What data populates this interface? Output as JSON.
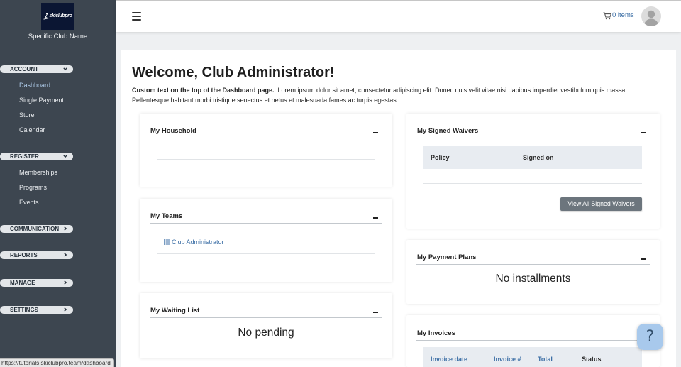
{
  "colors": {
    "sidebar_bg": "#3d4650",
    "accent": "#3b6ea5",
    "active_nav": "#b3d1f0",
    "button_bg": "#6c757d",
    "help_bg": "#a8c9ec",
    "page_bg": "#eef0f2"
  },
  "sidebar": {
    "logo": {
      "text": "skiclubpro",
      "icon": "skier-icon"
    },
    "club_name": "Specific Club Name",
    "sections": [
      {
        "label": "ACCOUNT",
        "chevron": "chevron-down-icon",
        "items": [
          {
            "label": "Dashboard",
            "active": true
          },
          {
            "label": "Single Payment"
          },
          {
            "label": "Store"
          },
          {
            "label": "Calendar"
          }
        ]
      },
      {
        "label": "REGISTER",
        "chevron": "chevron-down-icon",
        "items": [
          {
            "label": "Memberships"
          },
          {
            "label": "Programs"
          },
          {
            "label": "Events"
          }
        ]
      },
      {
        "label": "COMMUNICATION",
        "chevron": "chevron-right-icon"
      },
      {
        "label": "REPORTS",
        "chevron": "chevron-right-icon"
      },
      {
        "label": "MANAGE",
        "chevron": "chevron-right-icon"
      },
      {
        "label": "SETTINGS",
        "chevron": "chevron-right-icon"
      }
    ]
  },
  "header": {
    "menu_icon": "hamburger-icon",
    "cart_icon": "cart-icon",
    "cart_label": "0 items",
    "avatar_icon": "user-avatar-icon"
  },
  "main": {
    "title": "Welcome, Club Administrator!",
    "intro_bold": "Custom text on the top of the Dashboard page.",
    "intro_text": "Lorem ipsum dolor sit amet, consectetur adipiscing elit. Donec quis velit vitae nisi dapibus imperdiet vestibulum quis massa. Pellentesque habitant morbi tristique senectus et netus et malesuada fames ac turpis egestas.",
    "collapse_icon": "minus-icon",
    "cards": {
      "household": {
        "title": "My Household"
      },
      "teams": {
        "title": "My Teams",
        "links": [
          {
            "label": "Club Administrator",
            "icon": "list-icon"
          }
        ]
      },
      "waiting_list": {
        "title": "My Waiting List",
        "empty_text": "No pending"
      },
      "signed_waivers": {
        "title": "My Signed Waivers",
        "columns": [
          "Policy",
          "Signed on"
        ],
        "button_label": "View All Signed Waivers"
      },
      "payment_plans": {
        "title": "My Payment Plans",
        "empty_text": "No installments"
      },
      "invoices": {
        "title": "My Invoices",
        "columns": [
          "Invoice date",
          "Invoice #",
          "Total",
          "Status"
        ]
      }
    }
  },
  "help_button": {
    "label": "?"
  },
  "status_bar": {
    "url": "https://tutorials.skiclubpro.team/dashboard"
  }
}
